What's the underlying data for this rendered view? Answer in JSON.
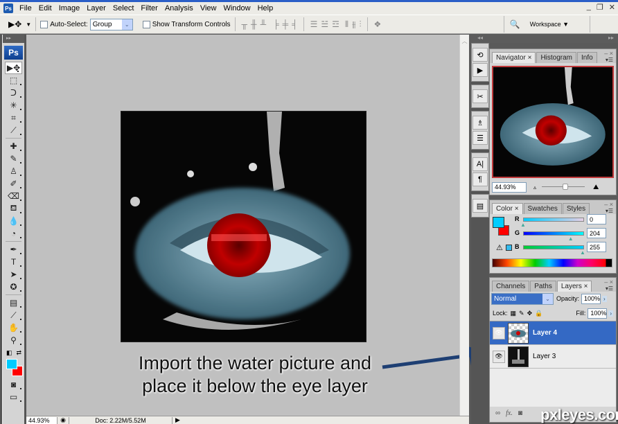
{
  "app": {
    "logo": "Ps"
  },
  "menu": [
    "File",
    "Edit",
    "Image",
    "Layer",
    "Select",
    "Filter",
    "Analysis",
    "View",
    "Window",
    "Help"
  ],
  "window_controls": {
    "minimize": "_",
    "restore": "❐",
    "close": "✕"
  },
  "options_bar": {
    "move_tool_icon": "▶✥",
    "auto_select_label": "Auto-Select:",
    "auto_select_checked": false,
    "auto_select_value": "Group",
    "show_transform_label": "Show Transform Controls",
    "show_transform_checked": false,
    "align_icons": [
      "align-top-icon",
      "align-vcenter-icon",
      "align-bottom-icon",
      "align-left-icon",
      "align-hcenter-icon",
      "align-right-icon"
    ],
    "distribute_icons": [
      "distribute-top-icon",
      "distribute-vcenter-icon",
      "distribute-bottom-icon",
      "distribute-left-icon",
      "distribute-hcenter-icon",
      "distribute-right-icon"
    ],
    "auto_align_icon": "auto-align-icon",
    "workspace_label": "Workspace ▼"
  },
  "toolbox": {
    "tools": [
      {
        "name": "move-tool",
        "glyph": "▶✥",
        "active": true
      },
      {
        "name": "marquee-tool",
        "glyph": "⬚"
      },
      {
        "name": "lasso-tool",
        "glyph": "ᑐ"
      },
      {
        "name": "magic-wand-tool",
        "glyph": "✳"
      },
      {
        "name": "crop-tool",
        "glyph": "⌗"
      },
      {
        "name": "slice-tool",
        "glyph": "⟋"
      },
      {
        "sep": true
      },
      {
        "name": "healing-brush-tool",
        "glyph": "✚"
      },
      {
        "name": "brush-tool",
        "glyph": "✎"
      },
      {
        "name": "clone-stamp-tool",
        "glyph": "♙"
      },
      {
        "name": "history-brush-tool",
        "glyph": "✐"
      },
      {
        "name": "eraser-tool",
        "glyph": "⌫"
      },
      {
        "name": "paint-bucket-tool",
        "glyph": "⛾"
      },
      {
        "name": "blur-tool",
        "glyph": "💧"
      },
      {
        "name": "dodge-tool",
        "glyph": "◔"
      },
      {
        "sep": true
      },
      {
        "name": "pen-tool",
        "glyph": "✒"
      },
      {
        "name": "type-tool",
        "glyph": "T"
      },
      {
        "name": "path-selection-tool",
        "glyph": "➤"
      },
      {
        "name": "shape-tool",
        "glyph": "✪"
      },
      {
        "sep": true
      },
      {
        "name": "notes-tool",
        "glyph": "▤"
      },
      {
        "name": "eyedropper-tool",
        "glyph": "⟋"
      },
      {
        "name": "hand-tool",
        "glyph": "✋"
      },
      {
        "name": "zoom-tool",
        "glyph": "⚲"
      }
    ],
    "foreground_color": "#00ccff",
    "background_color": "#ff0000",
    "quick_mask_glyph": "◙",
    "screen_mode_glyph": "▭"
  },
  "status_bar": {
    "zoom": "44.93%",
    "doc": "Doc: 2.22M/5.52M"
  },
  "annotation": {
    "line1": "Import the water picture and",
    "line2": "place it below the eye layer"
  },
  "navigator": {
    "tabs": [
      "Navigator",
      "Histogram",
      "Info"
    ],
    "zoom_value": "44.93%",
    "zoom_slider_fraction": 0.55
  },
  "color_panel": {
    "tabs": [
      "Color",
      "Swatches",
      "Styles"
    ],
    "channels": [
      {
        "label": "R",
        "value": "0",
        "fraction": 0.0
      },
      {
        "label": "G",
        "value": "204",
        "fraction": 0.8
      },
      {
        "label": "B",
        "value": "255",
        "fraction": 1.0
      }
    ],
    "foreground": "#00ccff",
    "background": "#ff0000",
    "gamut_warning_icon": "⚠"
  },
  "layers_panel": {
    "tabs": [
      "Channels",
      "Paths",
      "Layers"
    ],
    "blend_mode": "Normal",
    "opacity_label": "Opacity:",
    "opacity": "100%",
    "lock_label": "Lock:",
    "fill_label": "Fill:",
    "fill": "100%",
    "layers": [
      {
        "name": "Layer 4",
        "selected": true,
        "visible": true
      },
      {
        "name": "Layer 3",
        "selected": false,
        "visible": true
      }
    ],
    "footer_icons": [
      "link-icon",
      "fx-icon",
      "mask-icon"
    ],
    "fx_label": "fx."
  },
  "dock_icons": [
    "history-icon",
    "actions-icon",
    "tool-presets-icon",
    "clone-source-icon",
    "brushes-icon",
    "character-icon",
    "paragraph-icon",
    "layer-comps-icon"
  ],
  "watermark": "pxleyes.com"
}
